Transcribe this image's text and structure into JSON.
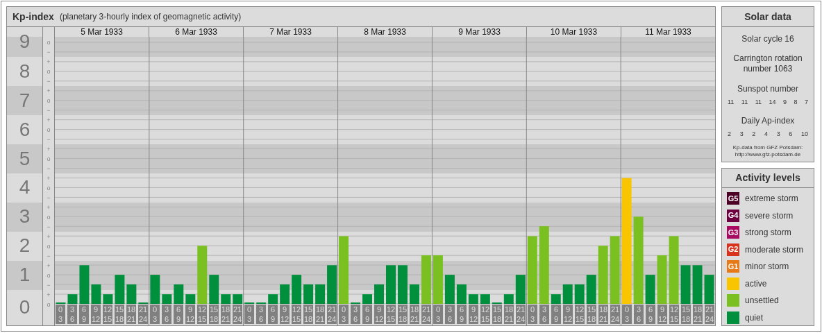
{
  "kp_panel": {
    "title": "Kp-index",
    "subtitle": "(planetary 3-hourly index of geomagnetic activity)",
    "chart_data": {
      "type": "bar",
      "ylim": [
        0,
        9.19
      ],
      "grid": true,
      "yticks": [
        {
          "value": 0,
          "label": "0"
        },
        {
          "value": 1,
          "label": "1"
        },
        {
          "value": 2,
          "label": "2"
        },
        {
          "value": 3,
          "label": "3"
        },
        {
          "value": 4,
          "label": "4"
        },
        {
          "value": 5,
          "label": "5"
        },
        {
          "value": 6,
          "label": "6"
        },
        {
          "value": 7,
          "label": "7"
        },
        {
          "value": 8,
          "label": "8"
        },
        {
          "value": 9,
          "label": "9"
        }
      ],
      "series": [
        {
          "values": [
            0,
            0.33,
            1.33,
            0.67,
            0.33,
            1,
            0.67,
            0,
            1,
            0.33,
            0.67,
            0.33,
            2,
            1,
            0.33,
            0.33,
            0,
            0,
            0.33,
            0.67,
            1,
            0.67,
            0.67,
            1.33,
            2.33,
            0,
            0.33,
            0.67,
            1.33,
            1.33,
            0.67,
            1.67,
            1.67,
            1,
            0.67,
            0.33,
            0.33,
            0,
            0.33,
            1,
            2.33,
            2.67,
            0.33,
            0.67,
            0.67,
            1,
            2,
            2.33,
            4.33,
            3,
            1,
            1.67,
            2.33,
            1.33,
            1.33,
            1
          ]
        }
      ]
    },
    "sublevel_marks": [
      "o",
      "−",
      "+",
      "o",
      "−",
      "+",
      "o",
      "−",
      "+",
      "o",
      "−",
      "+",
      "o",
      "−",
      "+",
      "o",
      "−",
      "+",
      "o",
      "−",
      "+",
      "o",
      "−",
      "+",
      "o",
      "−",
      "+",
      "o"
    ],
    "x_groups": [
      {
        "label": "5 Mar 1933",
        "slots": [
          {
            "start": "0",
            "end": "3"
          },
          {
            "start": "3",
            "end": "6"
          },
          {
            "start": "6",
            "end": "9"
          },
          {
            "start": "9",
            "end": "12"
          },
          {
            "start": "12",
            "end": "15"
          },
          {
            "start": "15",
            "end": "18"
          },
          {
            "start": "18",
            "end": "21"
          },
          {
            "start": "21",
            "end": "24"
          }
        ]
      },
      {
        "label": "6 Mar 1933",
        "slots": [
          {
            "start": "0",
            "end": "3"
          },
          {
            "start": "3",
            "end": "6"
          },
          {
            "start": "6",
            "end": "9"
          },
          {
            "start": "9",
            "end": "12"
          },
          {
            "start": "12",
            "end": "15"
          },
          {
            "start": "15",
            "end": "18"
          },
          {
            "start": "18",
            "end": "21"
          },
          {
            "start": "21",
            "end": "24"
          }
        ]
      },
      {
        "label": "7 Mar 1933",
        "slots": [
          {
            "start": "0",
            "end": "3"
          },
          {
            "start": "3",
            "end": "6"
          },
          {
            "start": "6",
            "end": "9"
          },
          {
            "start": "9",
            "end": "12"
          },
          {
            "start": "12",
            "end": "15"
          },
          {
            "start": "15",
            "end": "18"
          },
          {
            "start": "18",
            "end": "21"
          },
          {
            "start": "21",
            "end": "24"
          }
        ]
      },
      {
        "label": "8 Mar 1933",
        "slots": [
          {
            "start": "0",
            "end": "3"
          },
          {
            "start": "3",
            "end": "6"
          },
          {
            "start": "6",
            "end": "9"
          },
          {
            "start": "9",
            "end": "12"
          },
          {
            "start": "12",
            "end": "15"
          },
          {
            "start": "15",
            "end": "18"
          },
          {
            "start": "18",
            "end": "21"
          },
          {
            "start": "21",
            "end": "24"
          }
        ]
      },
      {
        "label": "9 Mar 1933",
        "slots": [
          {
            "start": "0",
            "end": "3"
          },
          {
            "start": "3",
            "end": "6"
          },
          {
            "start": "6",
            "end": "9"
          },
          {
            "start": "9",
            "end": "12"
          },
          {
            "start": "12",
            "end": "15"
          },
          {
            "start": "15",
            "end": "18"
          },
          {
            "start": "18",
            "end": "21"
          },
          {
            "start": "21",
            "end": "24"
          }
        ]
      },
      {
        "label": "10 Mar 1933",
        "slots": [
          {
            "start": "0",
            "end": "3"
          },
          {
            "start": "3",
            "end": "6"
          },
          {
            "start": "6",
            "end": "9"
          },
          {
            "start": "9",
            "end": "12"
          },
          {
            "start": "12",
            "end": "15"
          },
          {
            "start": "15",
            "end": "18"
          },
          {
            "start": "18",
            "end": "21"
          },
          {
            "start": "21",
            "end": "24"
          }
        ]
      },
      {
        "label": "11 Mar 1933",
        "slots": [
          {
            "start": "0",
            "end": "3"
          },
          {
            "start": "3",
            "end": "6"
          },
          {
            "start": "6",
            "end": "9"
          },
          {
            "start": "9",
            "end": "12"
          },
          {
            "start": "12",
            "end": "15"
          },
          {
            "start": "15",
            "end": "18"
          },
          {
            "start": "18",
            "end": "21"
          },
          {
            "start": "21",
            "end": "24"
          }
        ]
      }
    ]
  },
  "solar_data": {
    "title": "Solar data",
    "solar_cycle": "Solar cycle 16",
    "carrington": "Carrington rotation number 1063",
    "sunspot_label": "Sunspot number",
    "sunspot_values": [
      "11",
      "11",
      "11",
      "14",
      "9",
      "8",
      "7"
    ],
    "ap_label": "Daily Ap-index",
    "ap_values": [
      "2",
      "3",
      "2",
      "4",
      "3",
      "6",
      "10"
    ],
    "credit": "Kp-data from GFZ Potsdam:",
    "credit_link": "http://www.gfz-potsdam.de"
  },
  "activity_levels": {
    "title": "Activity levels",
    "items": [
      {
        "badge": "G5",
        "label": "extreme storm",
        "color": "#4c0026"
      },
      {
        "badge": "G4",
        "label": "severe storm",
        "color": "#6e0040"
      },
      {
        "badge": "G3",
        "label": "strong storm",
        "color": "#a80a62"
      },
      {
        "badge": "G2",
        "label": "moderate storm",
        "color": "#d8321e"
      },
      {
        "badge": "G1",
        "label": "minor storm",
        "color": "#e67a18"
      },
      {
        "label": "active",
        "color": "#f8c500"
      },
      {
        "label": "unsettled",
        "color": "#7ac020"
      },
      {
        "label": "quiet",
        "color": "#008f3c"
      }
    ]
  }
}
